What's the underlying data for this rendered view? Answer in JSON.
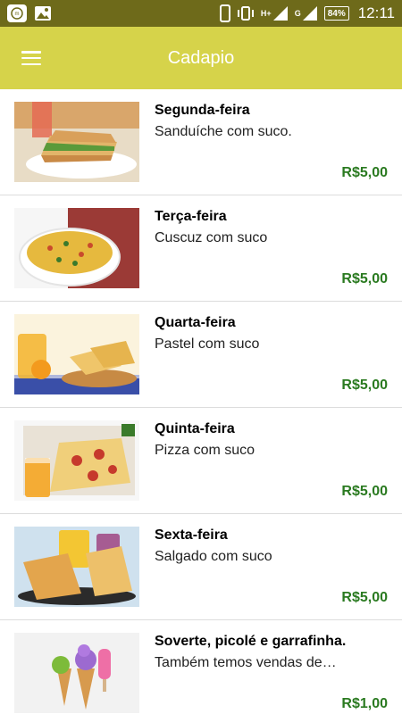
{
  "status_bar": {
    "network_label": "H+",
    "network_label_2": "G",
    "battery": "84%",
    "time": "12:11",
    "icons": [
      "notification-app-icon",
      "gallery-icon",
      "phone-icon",
      "vibrate-icon",
      "signal-icon",
      "signal-icon",
      "battery-icon"
    ]
  },
  "app_bar": {
    "title": "Cadapio",
    "color": "#d6d34a",
    "menu_icon": "hamburger-menu-icon"
  },
  "items": [
    {
      "day": "Segunda-feira",
      "desc": "Sanduíche com suco.",
      "price": "R$5,00"
    },
    {
      "day": "Terça-feira",
      "desc": "Cuscuz com suco",
      "price": "R$5,00"
    },
    {
      "day": "Quarta-feira",
      "desc": "Pastel com suco",
      "price": "R$5,00"
    },
    {
      "day": "Quinta-feira",
      "desc": "Pizza com suco",
      "price": "R$5,00"
    },
    {
      "day": "Sexta-feira",
      "desc": "Salgado com suco",
      "price": "R$5,00"
    },
    {
      "day": "Soverte, picolé e garrafinha.",
      "desc": "Também temos vendas de…",
      "price": "R$1,00"
    }
  ],
  "colors": {
    "status_bar": "#6e6a1a",
    "price": "#2a7a20",
    "divider": "#dcdcdc"
  }
}
